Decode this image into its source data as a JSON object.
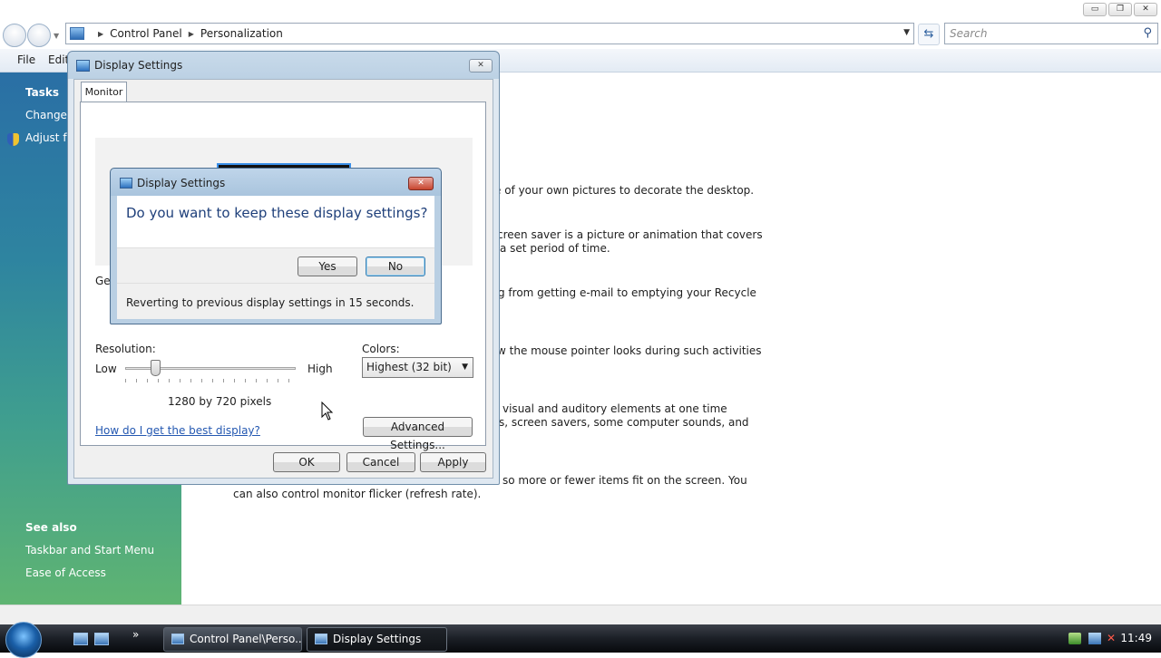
{
  "window": {
    "buttons": {
      "minimize": "▭",
      "maximize": "❐",
      "close": "✕"
    }
  },
  "address": {
    "crumbs": [
      "Control Panel",
      "Personalization"
    ],
    "search_placeholder": "Search"
  },
  "menu": {
    "file": "File",
    "edit": "Edit"
  },
  "left_pane": {
    "tasks_heading": "Tasks",
    "task_links": [
      "Change d",
      "Adjust fo"
    ],
    "see_also_heading": "See also",
    "see_also_links": [
      "Taskbar and Start Menu",
      "Ease of Access"
    ]
  },
  "background_text": [
    "e of your own pictures to decorate the desktop.",
    "creen saver is a picture or animation that covers",
    "a set period of time.",
    "g from getting e-mail to emptying your Recycle",
    "w the mouse pointer looks during such activities",
    "visual and auditory elements at one time",
    "s, screen savers, some computer sounds, and",
    "so more or fewer items fit on the screen. You",
    "can also control monitor flicker (refresh rate)."
  ],
  "display_dialog": {
    "title": "Display Settings",
    "close": "✕",
    "tab": "Monitor",
    "general_label": "Ger",
    "resolution_label": "Resolution:",
    "low_label": "Low",
    "high_label": "High",
    "resolution_value": "1280 by 720 pixels",
    "colors_label": "Colors:",
    "colors_value": "Highest (32 bit)",
    "help_link": "How do I get the best display?",
    "advanced_button": "Advanced Settings...",
    "ok_button": "OK",
    "cancel_button": "Cancel",
    "apply_button": "Apply",
    "slider_position_fraction": 0.18
  },
  "confirm_dialog": {
    "title": "Display Settings",
    "close": "✕",
    "question": "Do you want to keep these display settings?",
    "yes_button": "Yes",
    "no_button": "No",
    "revert_text": "Reverting to previous display settings in 15 seconds."
  },
  "taskbar": {
    "items": [
      "Control Panel\\Perso...",
      "Display Settings"
    ],
    "chevron": "»",
    "clock": "11:49"
  },
  "colors": {
    "accent": "#2458b1",
    "pane_top": "#2a6fa5",
    "pane_bottom": "#5fb472",
    "taskbar": "#1b1f26"
  }
}
